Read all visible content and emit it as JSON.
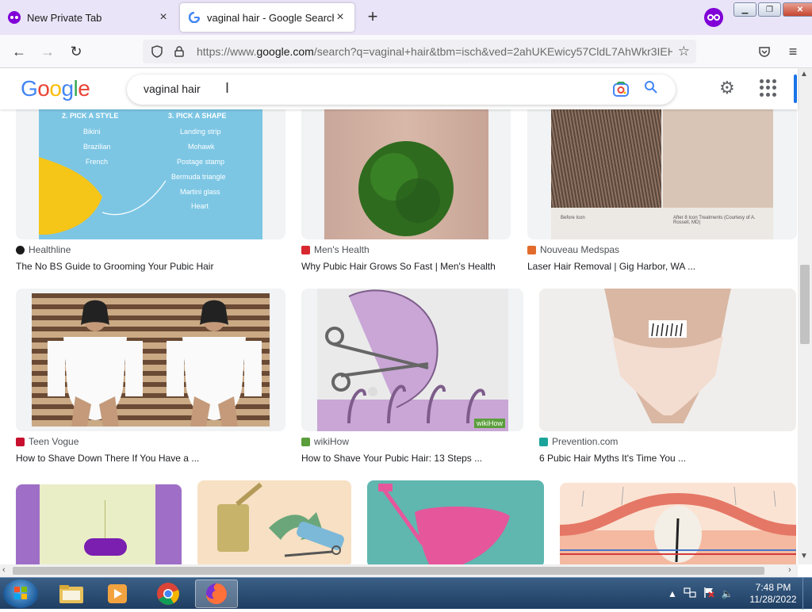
{
  "browser": {
    "tabs": [
      {
        "label": "New Private Tab",
        "active": false
      },
      {
        "label": "vaginal hair - Google Search",
        "active": true
      }
    ],
    "url_prefix": "https://www.",
    "url_host": "google.com",
    "url_rest": "/search?q=vaginal+hair&tbm=isch&ved=2ahUKEwicy57CldL7AhWkr3IEH"
  },
  "google": {
    "logo": "Google",
    "query": "vaginal hair"
  },
  "results": [
    {
      "source": "Healthline",
      "title": "The No BS Guide to Grooming Your Pubic Hair",
      "fav_color": "#1a1a1a",
      "thumb_text": [
        "2. PICK A STYLE",
        "Bikini",
        "Brazilian",
        "French",
        "3. PICK A SHAPE",
        "Landing strip",
        "Mohawk",
        "Postage stamp",
        "Bermuda triangle",
        "Martini glass",
        "Heart"
      ]
    },
    {
      "source": "Men's Health",
      "title": "Why Pubic Hair Grows So Fast | Men's Health",
      "fav_color": "#d8282f"
    },
    {
      "source": "Nouveau Medspas",
      "title": "Laser Hair Removal | Gig Harbor, WA ...",
      "fav_color": "#e26b2c",
      "thumb_text": [
        "Before Icon",
        "After 8 Icon Treatments (Courtesy of A. Rossell, MD)"
      ]
    },
    {
      "source": "Teen Vogue",
      "title": "How to Shave Down There If You Have a ...",
      "fav_color": "#c8102e"
    },
    {
      "source": "wikiHow",
      "title": "How to Shave Your Pubic Hair: 13 Steps ...",
      "fav_color": "#5a9e3c",
      "thumb_text": [
        "wikiHow"
      ]
    },
    {
      "source": "Prevention.com",
      "title": "6 Pubic Hair Myths It's Time You ...",
      "fav_color": "#1aa39a"
    }
  ],
  "taskbar": {
    "time": "7:48 PM",
    "date": "11/28/2022"
  }
}
